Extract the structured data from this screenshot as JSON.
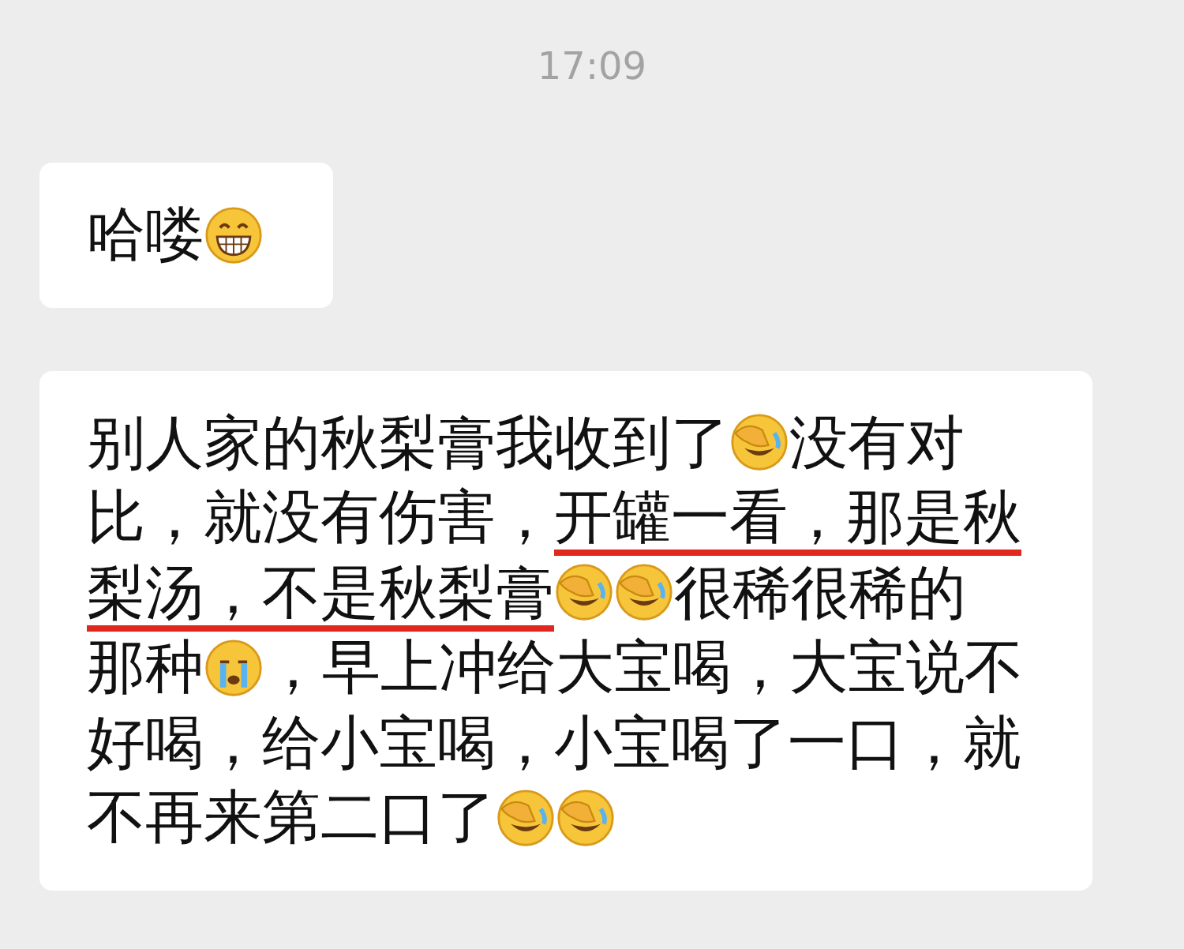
{
  "timestamp": "17:09",
  "messages": [
    {
      "lines": [
        [
          {
            "kind": "text",
            "text": "哈喽",
            "underlined": false
          },
          {
            "kind": "grin"
          }
        ]
      ]
    },
    {
      "lines": [
        [
          {
            "kind": "text",
            "text": "别人家的秋梨膏我收到了",
            "underlined": false
          },
          {
            "kind": "facepalm"
          },
          {
            "kind": "text",
            "text": "没有对",
            "underlined": false
          }
        ],
        [
          {
            "kind": "text",
            "text": "比，就没有伤害，",
            "underlined": false
          },
          {
            "kind": "text",
            "text": "开罐一看，那是秋",
            "underlined": true
          }
        ],
        [
          {
            "kind": "text",
            "text": "梨汤，不是秋梨膏",
            "underlined": true
          },
          {
            "kind": "facepalm"
          },
          {
            "kind": "facepalm"
          },
          {
            "kind": "text",
            "text": "很稀很稀的",
            "underlined": false
          }
        ],
        [
          {
            "kind": "text",
            "text": "那种",
            "underlined": false
          },
          {
            "kind": "cry"
          },
          {
            "kind": "text",
            "text": "，早上冲给大宝喝，大宝说不",
            "underlined": false
          }
        ],
        [
          {
            "kind": "text",
            "text": "好喝，给小宝喝，小宝喝了一口，就",
            "underlined": false
          }
        ],
        [
          {
            "kind": "text",
            "text": "不再来第二口了",
            "underlined": false
          },
          {
            "kind": "facepalm"
          },
          {
            "kind": "facepalm"
          }
        ]
      ]
    }
  ]
}
